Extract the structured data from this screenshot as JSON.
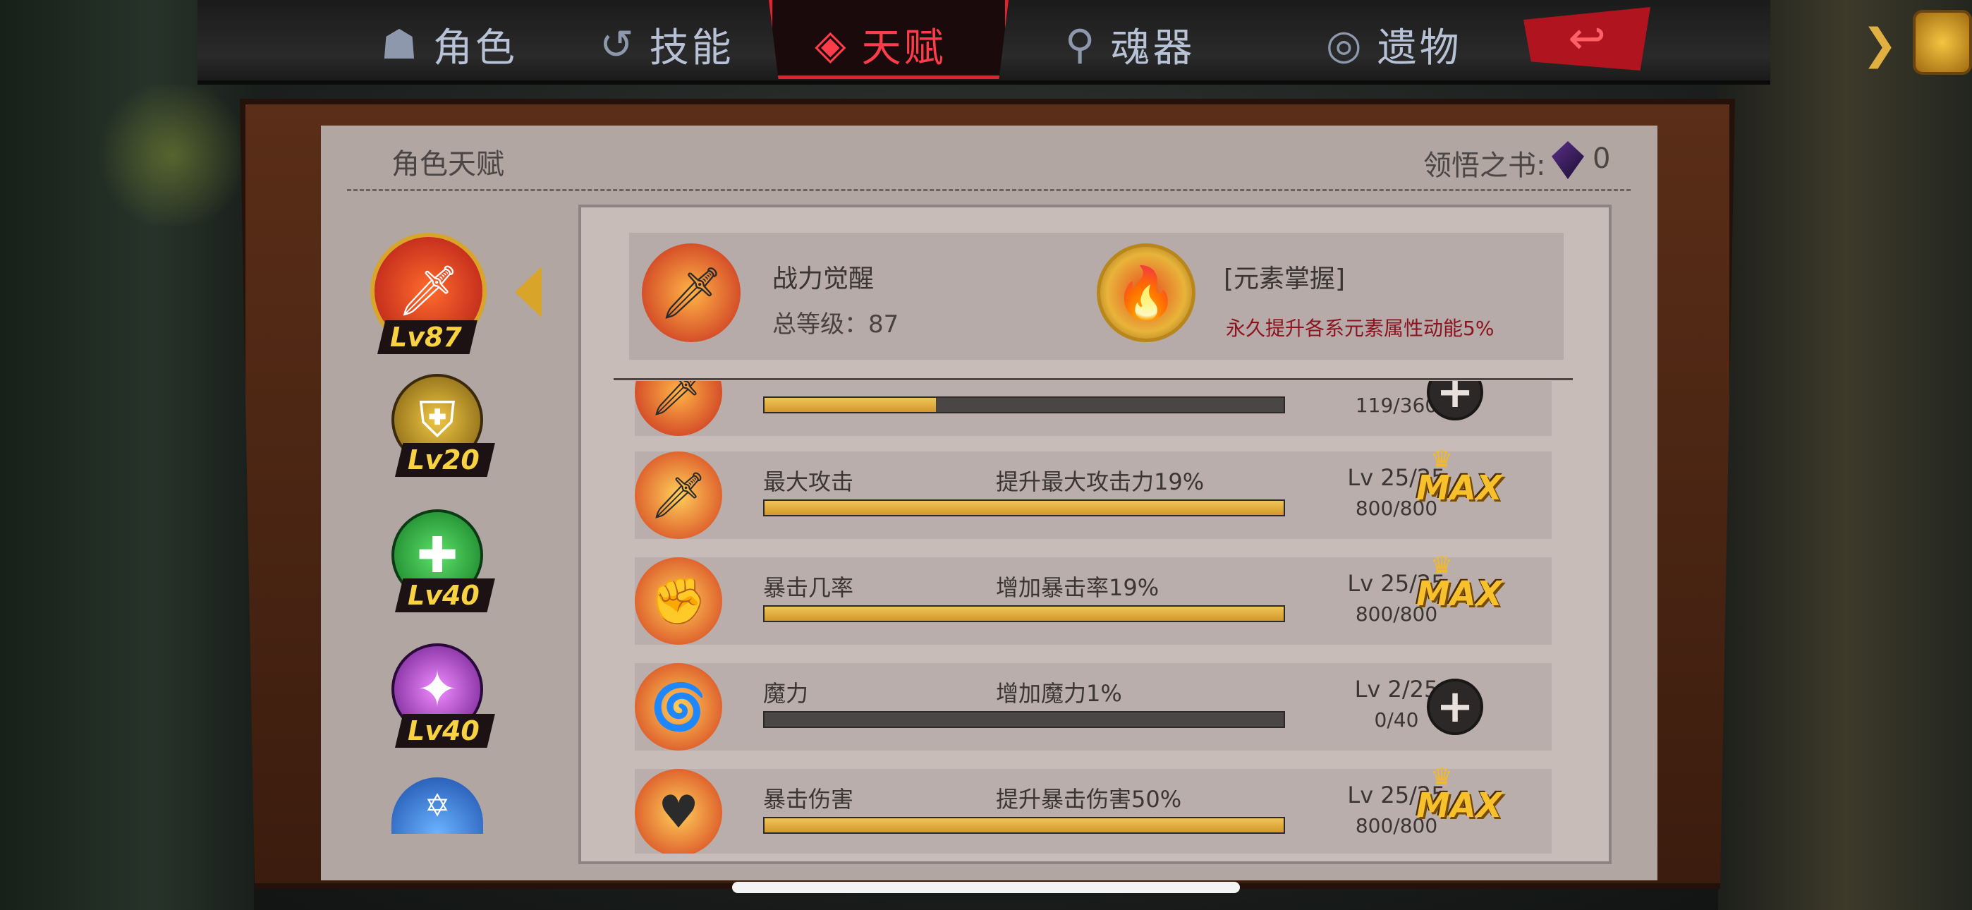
{
  "tabs": [
    {
      "label": "角色",
      "icon": "character-icon",
      "active": false
    },
    {
      "label": "技能",
      "icon": "skill-icon",
      "active": false
    },
    {
      "label": "天赋",
      "icon": "talent-icon",
      "active": true
    },
    {
      "label": "魂器",
      "icon": "soul-vessel-icon",
      "active": false
    },
    {
      "label": "遗物",
      "icon": "relic-icon",
      "active": false
    }
  ],
  "panel": {
    "title": "角色天赋",
    "book_label": "领悟之书:",
    "book_count": "0"
  },
  "tree_nodes": [
    {
      "lv": "Lv87",
      "color": "#d8322a",
      "icon": "sword-flame-icon",
      "selected": true
    },
    {
      "lv": "Lv20",
      "color": "#c9a020",
      "icon": "shield-icon",
      "selected": false
    },
    {
      "lv": "Lv40",
      "color": "#2fbf48",
      "icon": "heal-cross-icon",
      "selected": false
    },
    {
      "lv": "Lv40",
      "color": "#b23bdc",
      "icon": "magic-star-icon",
      "selected": false
    },
    {
      "lv": "",
      "color": "#2a6ed8",
      "icon": "water-star-icon",
      "selected": false
    }
  ],
  "header": {
    "left_name": "战力觉醒",
    "left_sub": "总等级：87",
    "right_name": "[元素掌握]",
    "right_desc": "永久提升各系元素属性动能5%"
  },
  "talents": [
    {
      "name": "",
      "desc": "",
      "lv": "",
      "progress_text": "119/360",
      "progress": 0.33,
      "state": "plus"
    },
    {
      "name": "最大攻击",
      "desc": "提升最大攻击力19%",
      "lv": "Lv 25/25",
      "progress_text": "800/800",
      "progress": 1.0,
      "state": "max"
    },
    {
      "name": "暴击几率",
      "desc": "增加暴击率19%",
      "lv": "Lv 25/25",
      "progress_text": "800/800",
      "progress": 1.0,
      "state": "max"
    },
    {
      "name": "魔力",
      "desc": "增加魔力1%",
      "lv": "Lv 2/25",
      "progress_text": "0/40",
      "progress": 0.0,
      "state": "plus"
    },
    {
      "name": "暴击伤害",
      "desc": "提升暴击伤害50%",
      "lv": "Lv 25/25",
      "progress_text": "800/800",
      "progress": 1.0,
      "state": "max"
    }
  ],
  "max_label": "MAX",
  "colors": {
    "accent": "#ff3c4a",
    "gold": "#f7c12e",
    "panel": "#b1a6a2"
  }
}
